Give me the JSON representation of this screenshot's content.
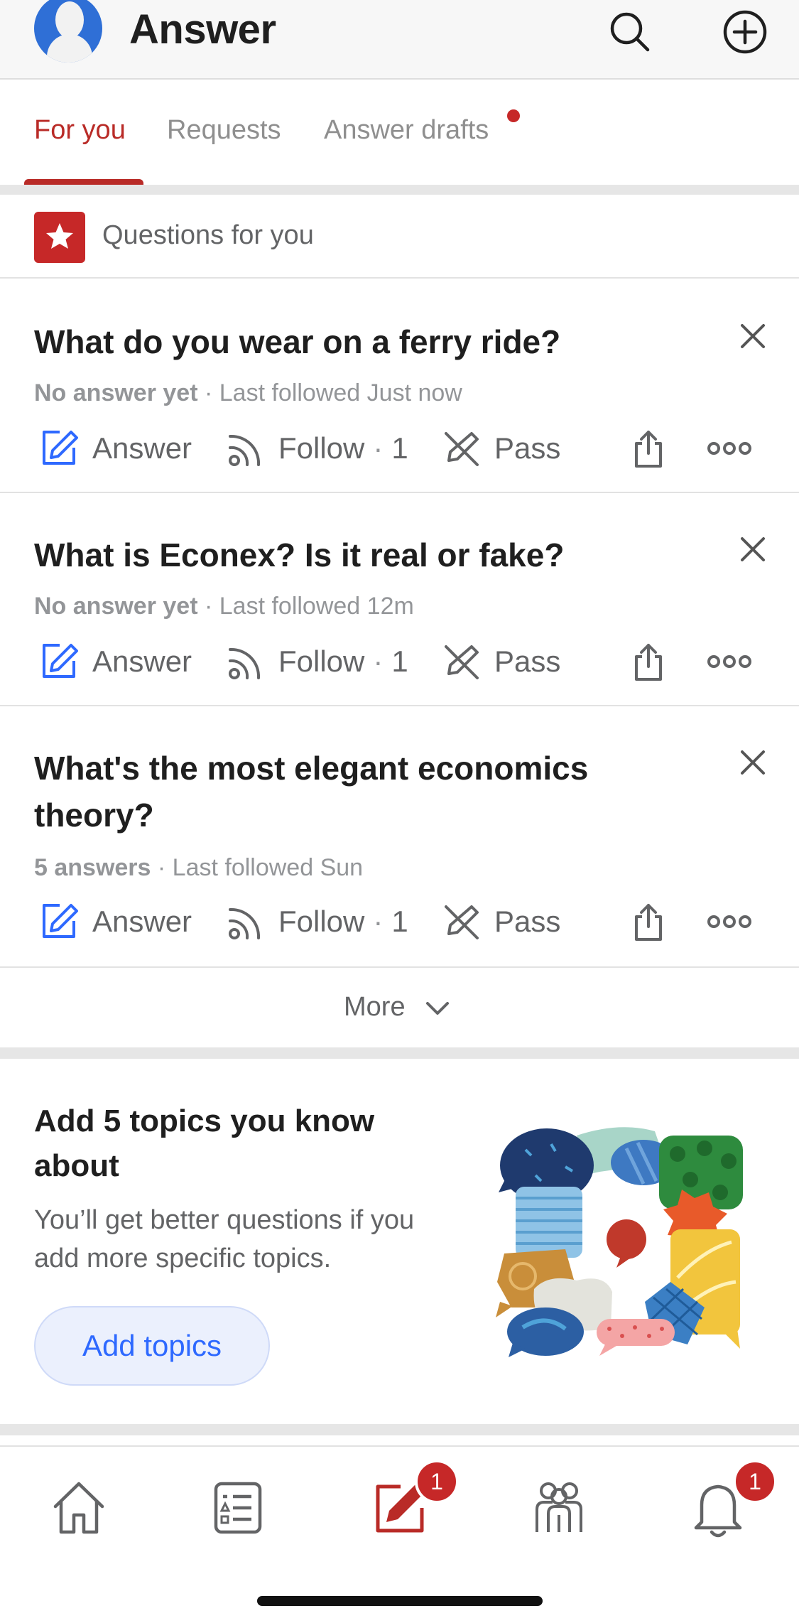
{
  "header": {
    "title": "Answer",
    "icons": [
      "avatar",
      "search-icon",
      "add-circle-icon"
    ]
  },
  "tabs": [
    {
      "label": "For you",
      "active": true
    },
    {
      "label": "Requests",
      "active": false
    },
    {
      "label": "Answer drafts",
      "active": false,
      "has_dot": true
    }
  ],
  "section": {
    "label": "Questions for you",
    "icon": "star-icon"
  },
  "actions": {
    "answer": "Answer",
    "follow": "Follow",
    "follow_sep": "·",
    "pass": "Pass"
  },
  "questions": [
    {
      "title": "What do you wear on a ferry ride?",
      "status": "No answer yet",
      "last_followed": "· Last followed Just now",
      "follow_count": "1"
    },
    {
      "title": "What is Econex? Is it real or fake?",
      "status": "No answer yet",
      "last_followed": "· Last followed 12m",
      "follow_count": "1"
    },
    {
      "title": "What's the most elegant economics theory?",
      "status": "5 answers",
      "last_followed": "· Last followed Sun",
      "follow_count": "1"
    }
  ],
  "more": {
    "label": "More"
  },
  "topics_card": {
    "title": "Add 5 topics you know about",
    "description": "You’ll get better questions if you add more specific topics.",
    "button": "Add topics"
  },
  "bottom_nav": {
    "items": [
      "home-icon",
      "following-icon",
      "answer-icon",
      "spaces-icon",
      "notifications-icon"
    ],
    "answer_badge": "1",
    "notifications_badge": "1"
  },
  "colors": {
    "brand_red": "#b92b27",
    "badge_red": "#c62828",
    "link_blue": "#2e69ff"
  }
}
